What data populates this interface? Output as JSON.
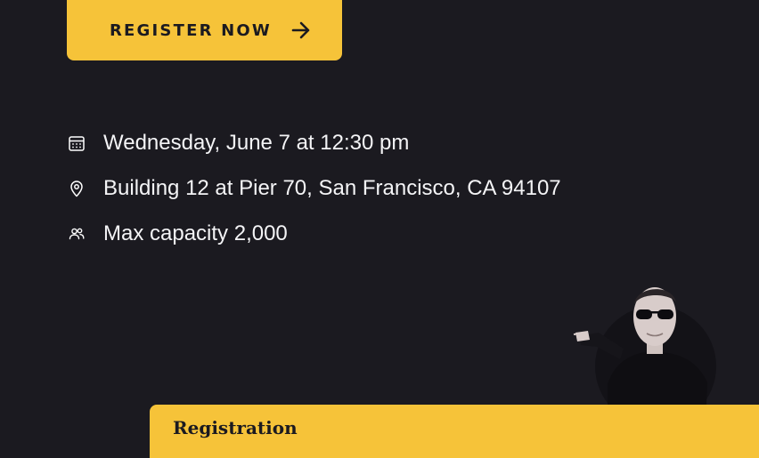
{
  "cta": {
    "label": "REGISTER NOW",
    "icon": "arrow-right-icon",
    "accent": "#f6c339"
  },
  "event": {
    "details": [
      {
        "icon": "calendar-icon",
        "text": "Wednesday, June 7 at 12:30 pm"
      },
      {
        "icon": "location-pin-icon",
        "text": "Building 12 at Pier 70, San Francisco, CA 94107"
      },
      {
        "icon": "users-icon",
        "text": "Max capacity 2,000"
      }
    ]
  },
  "registration_card": {
    "title": "Registration"
  },
  "colors": {
    "background": "#1b1a20",
    "accent": "#f6c339",
    "text": "#ffffff"
  }
}
